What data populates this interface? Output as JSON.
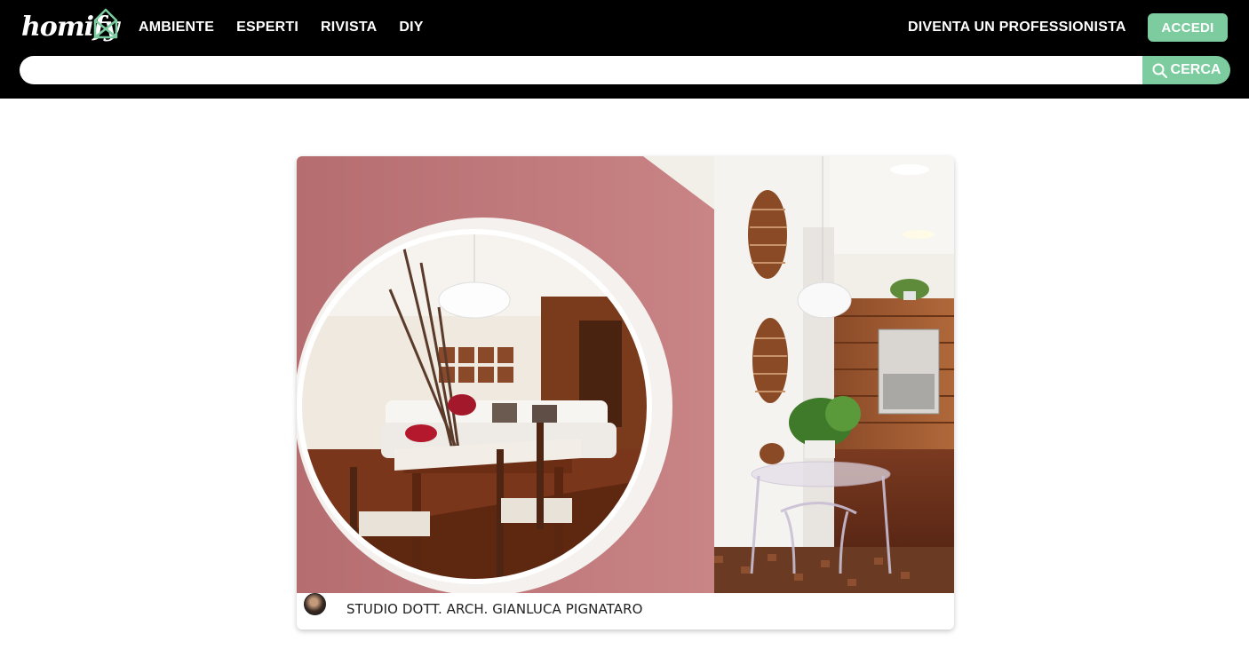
{
  "brand": {
    "logo_text": "homify",
    "accent": "#7ccca0",
    "header_bg": "#000000"
  },
  "nav": {
    "items": [
      {
        "label": "AMBIENTE"
      },
      {
        "label": "ESPERTI"
      },
      {
        "label": "RIVISTA"
      },
      {
        "label": "DIY"
      }
    ]
  },
  "header": {
    "pro_label": "DIVENTA UN PROFESSIONISTA",
    "login_label": "ACCEDI"
  },
  "search": {
    "placeholder": "",
    "value": "",
    "button_label": "CERCA",
    "icon": "search-icon"
  },
  "card": {
    "image_alt": "Living room and kitchen with circular wall opening",
    "author": "STUDIO DOTT. ARCH. GIANLUCA PIGNATARO",
    "author_avatar": "avatar"
  }
}
